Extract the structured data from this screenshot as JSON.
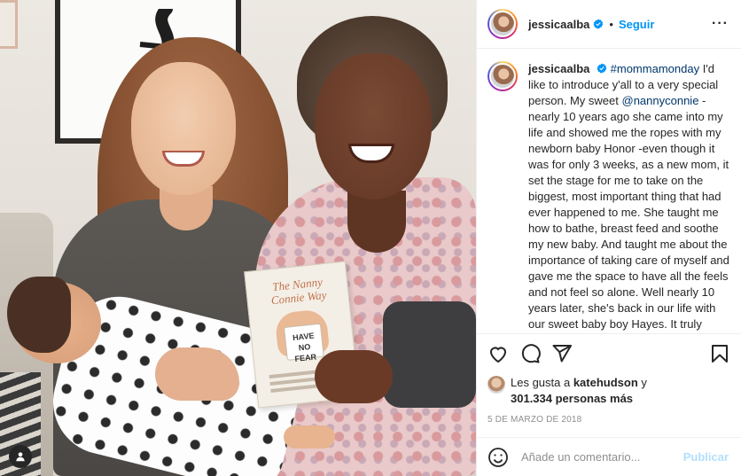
{
  "header": {
    "username": "jessicaalba",
    "separator": "•",
    "follow_label": "Seguir",
    "more_label": "···"
  },
  "caption": {
    "username": "jessicaalba",
    "hashtag": "#mommamonday",
    "part1": " I'd like to introduce y'all to a very special person. My sweet ",
    "mention": "@nannyconnie",
    "part2": " -nearly 10 years ago she came into my life and showed me the ropes with my newborn baby Honor -even though it was for only 3 weeks, as a new mom, it set the stage for me to take on the biggest, most important thing that had ever happened to me. She taught me how to bathe, breast feed and soothe my new baby. And taught me about the importance of taking care of myself and gave me the space to have all the feels and not feel so alone. Well nearly 10 years later, she's back in our life with our sweet baby boy Hayes. It truly takes a village to raise kiddos- whether it's your blood family or chosen family, you need to kick from"
  },
  "likes": {
    "prefix": "Les gusta a ",
    "liker": "katehudson",
    "connector": " y",
    "count": "301.334 personas más"
  },
  "date": "5 de marzo de 2018",
  "comment": {
    "placeholder": "Añade un comentario...",
    "publish_label": "Publicar"
  },
  "book": {
    "title": "The Nanny Connie Way",
    "badge": "HAVE NO FEAR"
  },
  "icons": {
    "like": "heart-icon",
    "comment": "comment-icon",
    "share": "share-icon",
    "save": "bookmark-icon",
    "emoji": "emoji-icon",
    "verified": "verified-badge-icon",
    "tag": "user-tag-icon"
  },
  "colors": {
    "follow": "#0095f6",
    "publish_disabled": "#b2dffc",
    "link": "#00376b",
    "verified": "#0095f6",
    "text": "#262626",
    "muted": "#8e8e8e"
  }
}
